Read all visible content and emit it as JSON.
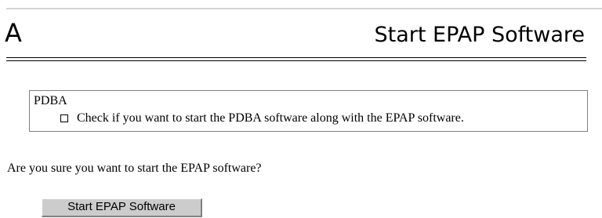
{
  "header": {
    "letter": "A",
    "title": "Start EPAP Software"
  },
  "pdba": {
    "title": "PDBA",
    "checkbox_label": "Check if you want to start the PDBA software along with the EPAP software.",
    "checked": false
  },
  "confirm": {
    "question": "Are you sure you want to start the EPAP software?",
    "button_label": "Start EPAP Software"
  }
}
